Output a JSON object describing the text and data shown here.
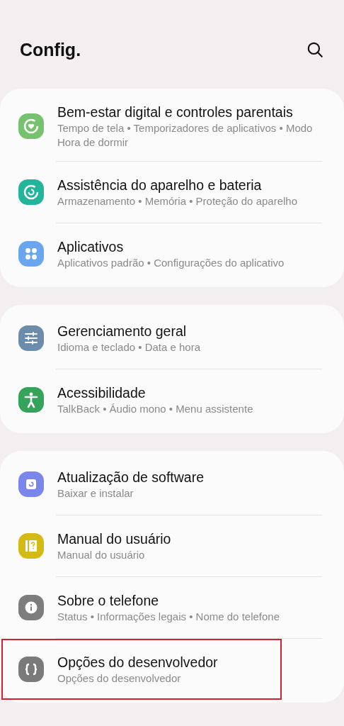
{
  "header": {
    "title": "Config."
  },
  "groups": [
    {
      "items": [
        {
          "title": "Bem-estar digital e controles parentais",
          "subtitle": "Tempo de tela  •  Temporizadores de aplicativos  •  Modo Hora de dormir",
          "highlighted": false
        },
        {
          "title": "Assistência do aparelho e bateria",
          "subtitle": "Armazenamento  •  Memória  •  Proteção do aparelho",
          "highlighted": false
        },
        {
          "title": "Aplicativos",
          "subtitle": "Aplicativos padrão  •  Configurações do aplicativo",
          "highlighted": false
        }
      ]
    },
    {
      "items": [
        {
          "title": "Gerenciamento geral",
          "subtitle": "Idioma e teclado  •  Data e hora",
          "highlighted": false
        },
        {
          "title": "Acessibilidade",
          "subtitle": "TalkBack  •  Áudio mono  •  Menu assistente",
          "highlighted": false
        }
      ]
    },
    {
      "items": [
        {
          "title": "Atualização de software",
          "subtitle": "Baixar e instalar",
          "highlighted": false
        },
        {
          "title": "Manual do usuário",
          "subtitle": "Manual do usuário",
          "highlighted": false
        },
        {
          "title": "Sobre o telefone",
          "subtitle": "Status  •  Informações legais  •  Nome do telefone",
          "highlighted": false
        },
        {
          "title": "Opções do desenvolvedor",
          "subtitle": "Opções do desenvolvedor",
          "highlighted": true
        }
      ]
    }
  ]
}
